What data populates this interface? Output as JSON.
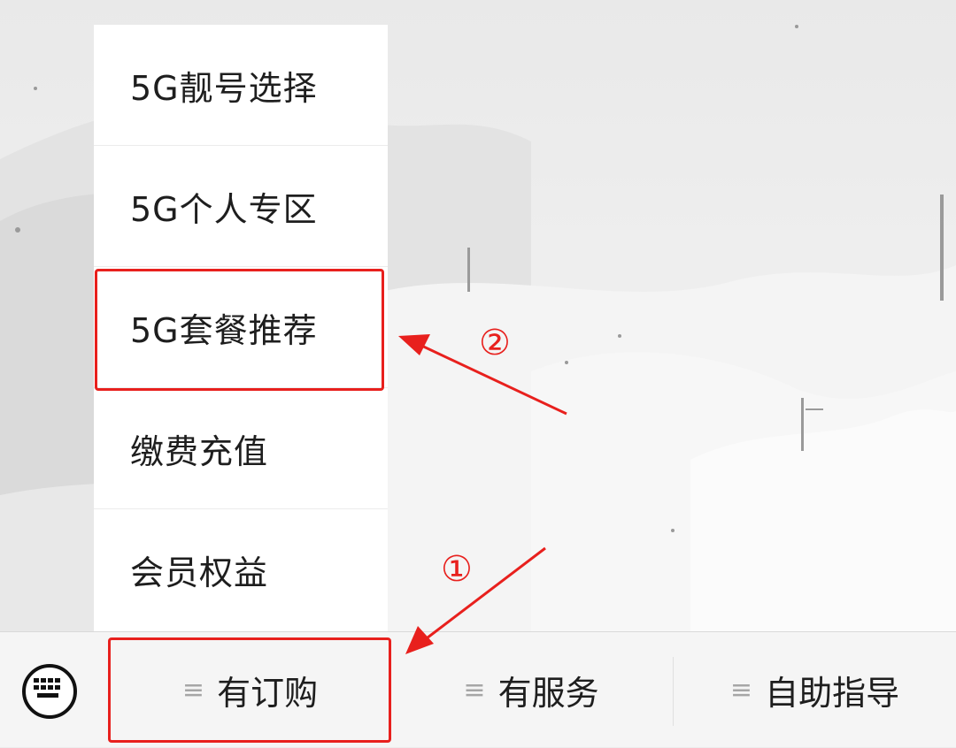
{
  "menu": {
    "items": [
      {
        "label": "5G靓号选择"
      },
      {
        "label": "5G个人专区"
      },
      {
        "label": "5G套餐推荐"
      },
      {
        "label": "缴费充值"
      },
      {
        "label": "会员权益"
      }
    ]
  },
  "bottom_bar": {
    "keyboard_icon": "keyboard-icon",
    "tabs": [
      {
        "label": "有订购",
        "icon": "menu-lines-icon"
      },
      {
        "label": "有服务",
        "icon": "menu-lines-icon"
      },
      {
        "label": "自助指导",
        "icon": "menu-lines-icon"
      }
    ]
  },
  "annotations": {
    "step1": "①",
    "step2": "②",
    "color": "#e8201d"
  }
}
